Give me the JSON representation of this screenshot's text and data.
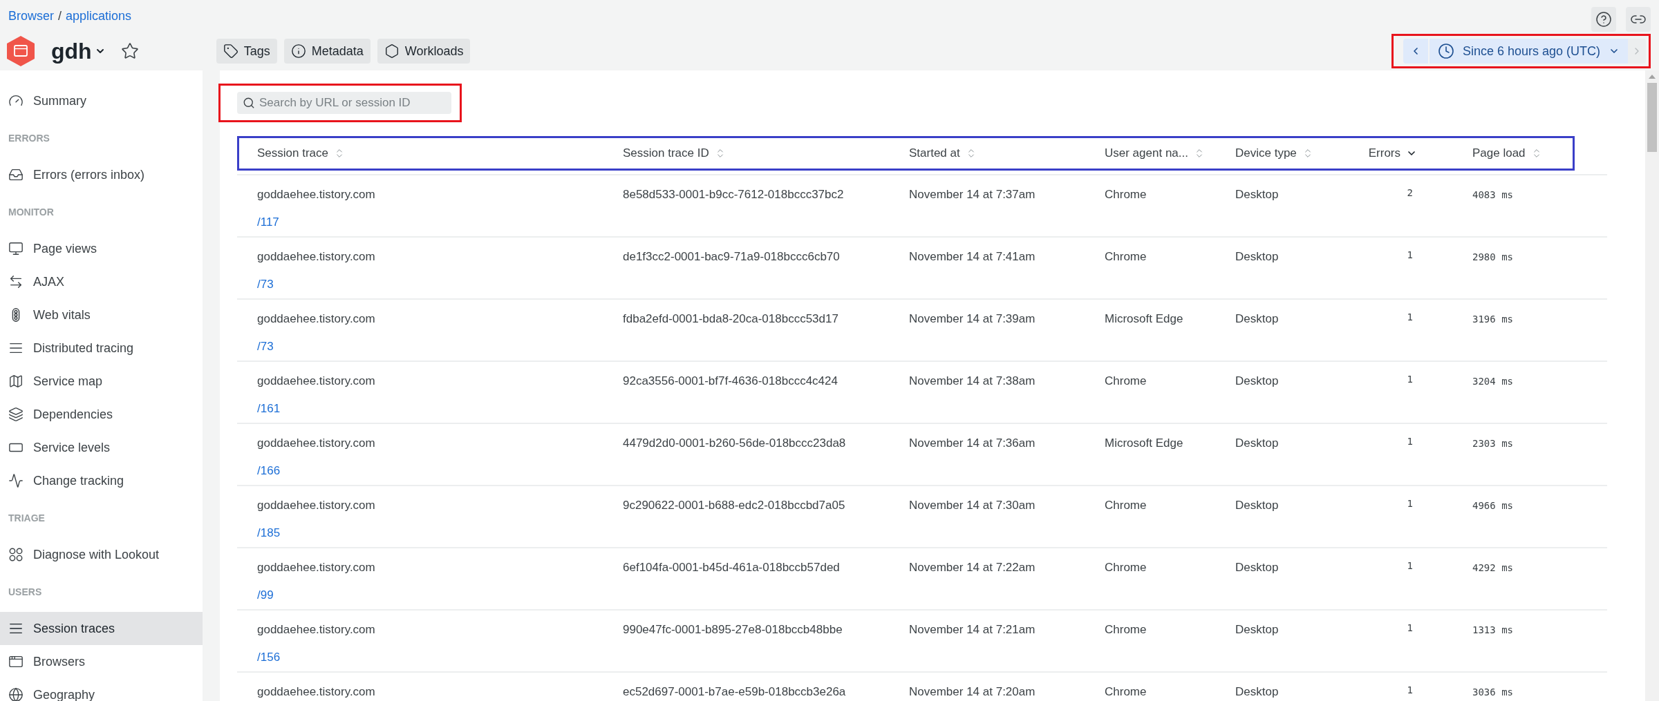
{
  "breadcrumb": [
    {
      "label": "Browser"
    },
    {
      "label": "applications"
    }
  ],
  "breadcrumb_separator": "/",
  "app": {
    "name": "gdh"
  },
  "header_buttons": [
    {
      "label": "Tags"
    },
    {
      "label": "Metadata"
    },
    {
      "label": "Workloads"
    }
  ],
  "time_picker": {
    "label": "Since 6 hours ago (UTC)",
    "next_disabled": true
  },
  "sidebar": {
    "sections": [
      {
        "items": [
          {
            "label": "Summary",
            "selected": false
          }
        ]
      },
      {
        "heading": "ERRORS",
        "items": [
          {
            "label": "Errors (errors inbox)",
            "selected": false
          }
        ]
      },
      {
        "heading": "MONITOR",
        "items": [
          {
            "label": "Page views",
            "selected": false
          },
          {
            "label": "AJAX",
            "selected": false
          },
          {
            "label": "Web vitals",
            "selected": false
          },
          {
            "label": "Distributed tracing",
            "selected": false
          },
          {
            "label": "Service map",
            "selected": false
          },
          {
            "label": "Dependencies",
            "selected": false
          },
          {
            "label": "Service levels",
            "selected": false
          },
          {
            "label": "Change tracking",
            "selected": false
          }
        ]
      },
      {
        "heading": "TRIAGE",
        "items": [
          {
            "label": "Diagnose with Lookout",
            "selected": false
          }
        ]
      },
      {
        "heading": "USERS",
        "items": [
          {
            "label": "Session traces",
            "selected": true
          },
          {
            "label": "Browsers",
            "selected": false
          },
          {
            "label": "Geography",
            "selected": false
          }
        ]
      }
    ]
  },
  "search": {
    "placeholder": "Search by URL or session ID"
  },
  "table": {
    "columns": [
      {
        "label": "Session trace",
        "sorted": false
      },
      {
        "label": "Session trace ID",
        "sorted": false
      },
      {
        "label": "Started at",
        "sorted": false
      },
      {
        "label": "User agent na...",
        "sorted": false
      },
      {
        "label": "Device type",
        "sorted": false
      },
      {
        "label": "Errors",
        "sorted": true
      },
      {
        "label": "Page load",
        "sorted": false
      }
    ],
    "rows": [
      {
        "host": "goddaehee.tistory.com",
        "path": "/117",
        "id": "8e58d533-0001-b9cc-7612-018bccc37bc2",
        "started": "November 14 at 7:37am",
        "agent": "Chrome",
        "device": "Desktop",
        "errors": "2",
        "page_load": "4083 ms"
      },
      {
        "host": "goddaehee.tistory.com",
        "path": "/73",
        "id": "de1f3cc2-0001-bac9-71a9-018bccc6cb70",
        "started": "November 14 at 7:41am",
        "agent": "Chrome",
        "device": "Desktop",
        "errors": "1",
        "page_load": "2980 ms"
      },
      {
        "host": "goddaehee.tistory.com",
        "path": "/73",
        "id": "fdba2efd-0001-bda8-20ca-018bccc53d17",
        "started": "November 14 at 7:39am",
        "agent": "Microsoft Edge",
        "device": "Desktop",
        "errors": "1",
        "page_load": "3196 ms"
      },
      {
        "host": "goddaehee.tistory.com",
        "path": "/161",
        "id": "92ca3556-0001-bf7f-4636-018bccc4c424",
        "started": "November 14 at 7:38am",
        "agent": "Chrome",
        "device": "Desktop",
        "errors": "1",
        "page_load": "3204 ms"
      },
      {
        "host": "goddaehee.tistory.com",
        "path": "/166",
        "id": "4479d2d0-0001-b260-56de-018bccc23da8",
        "started": "November 14 at 7:36am",
        "agent": "Microsoft Edge",
        "device": "Desktop",
        "errors": "1",
        "page_load": "2303 ms"
      },
      {
        "host": "goddaehee.tistory.com",
        "path": "/185",
        "id": "9c290622-0001-b688-edc2-018bccbd7a05",
        "started": "November 14 at 7:30am",
        "agent": "Chrome",
        "device": "Desktop",
        "errors": "1",
        "page_load": "4966 ms"
      },
      {
        "host": "goddaehee.tistory.com",
        "path": "/99",
        "id": "6ef104fa-0001-b45d-461a-018bccb57ded",
        "started": "November 14 at 7:22am",
        "agent": "Chrome",
        "device": "Desktop",
        "errors": "1",
        "page_load": "4292 ms"
      },
      {
        "host": "goddaehee.tistory.com",
        "path": "/156",
        "id": "990e47fc-0001-b895-27e8-018bccb48bbe",
        "started": "November 14 at 7:21am",
        "agent": "Chrome",
        "device": "Desktop",
        "errors": "1",
        "page_load": "1313 ms"
      },
      {
        "host": "goddaehee.tistory.com",
        "id": "ec52d697-0001-b7ae-e59b-018bccb3e26a",
        "started": "November 14 at 7:20am",
        "agent": "Chrome",
        "device": "Desktop",
        "errors": "1",
        "page_load": "3036 ms"
      }
    ]
  }
}
